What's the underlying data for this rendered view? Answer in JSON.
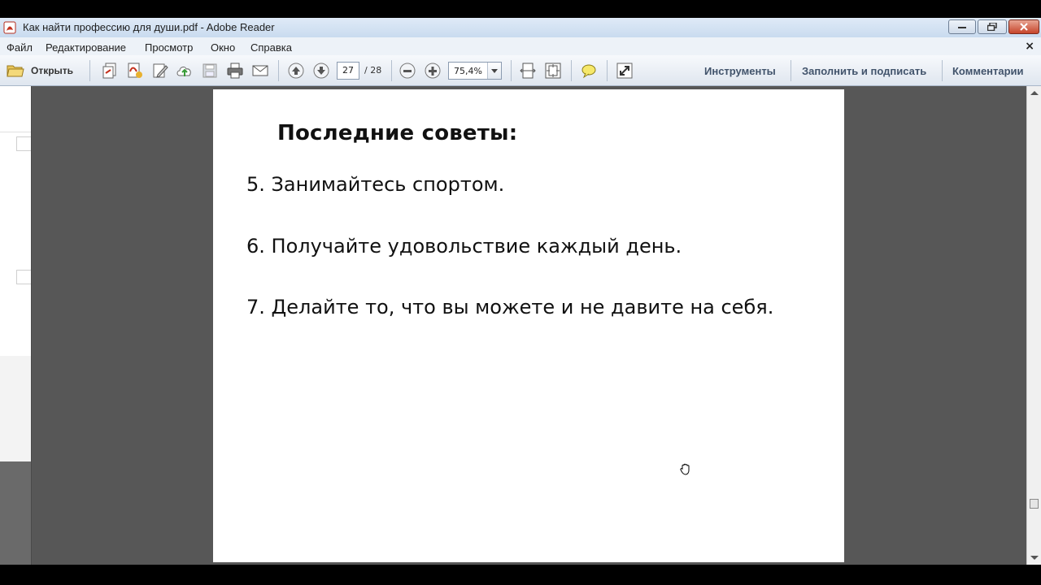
{
  "window": {
    "title": "Как найти профессию для души.pdf - Adobe Reader"
  },
  "menu": {
    "items": [
      "Файл",
      "Редактирование",
      "Просмотр",
      "Окно",
      "Справка"
    ],
    "close_doc": "×"
  },
  "toolbar": {
    "open_label": "Открыть",
    "current_page": "27",
    "total_pages": "/ 28",
    "zoom": "75,4%",
    "tools_label": "Инструменты",
    "fill_sign_label": "Заполнить и подписать",
    "comments_label": "Комментарии"
  },
  "document": {
    "heading": "Последние советы:",
    "items": [
      "5. Занимайтесь спортом.",
      "6. Получайте удовольствие каждый день.",
      "7. Делайте то, что вы можете и не давите на себя."
    ]
  },
  "colors": {
    "viewer_background": "#575757",
    "title_bar": "#c9dbef",
    "toolbar_text": "#41536b"
  }
}
